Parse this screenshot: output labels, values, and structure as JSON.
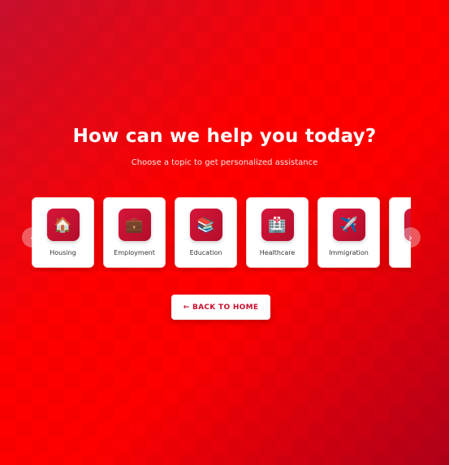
{
  "header": {
    "title": "How can we help you today?",
    "subtitle": "Choose a topic to get personalized assistance"
  },
  "topics": [
    {
      "label": "Housing",
      "icon": "house-icon",
      "glyph": "🏠"
    },
    {
      "label": "Employment",
      "icon": "briefcase-icon",
      "glyph": "💼"
    },
    {
      "label": "Education",
      "icon": "books-icon",
      "glyph": "📚"
    },
    {
      "label": "Healthcare",
      "icon": "hospital-icon",
      "glyph": "🏥"
    },
    {
      "label": "Immigration",
      "icon": "airplane-icon",
      "glyph": "✈️"
    },
    {
      "label": "",
      "icon": "partial-card",
      "glyph": ""
    }
  ],
  "nav": {
    "prev_glyph": "‹",
    "next_glyph": "›"
  },
  "back_button": {
    "label": "← BACK TO HOME"
  },
  "colors": {
    "background": "#ff0000",
    "accent": "#c8102e",
    "card": "#ffffff"
  }
}
